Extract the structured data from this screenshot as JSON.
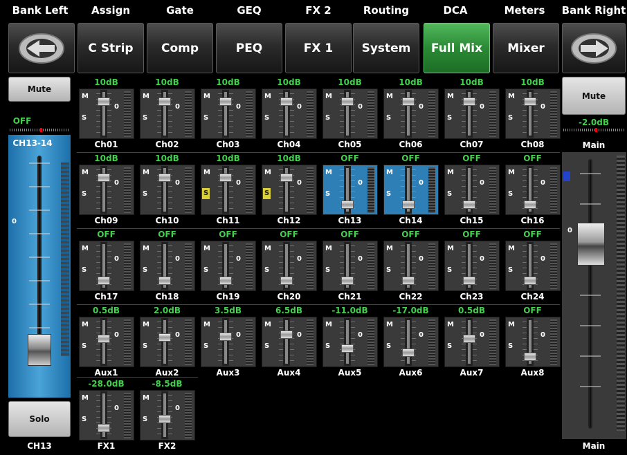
{
  "top_labels": [
    "Bank Left",
    "Assign",
    "Gate",
    "GEQ",
    "FX 2",
    "Routing",
    "DCA",
    "Meters",
    "Bank Right"
  ],
  "tabs": [
    {
      "label": "",
      "name": "bank-left-button",
      "icon": "arrow-left-icon"
    },
    {
      "label": "C Strip",
      "name": "tab-c-strip"
    },
    {
      "label": "Comp",
      "name": "tab-comp"
    },
    {
      "label": "PEQ",
      "name": "tab-peq"
    },
    {
      "label": "FX 1",
      "name": "tab-fx1"
    },
    {
      "label": "System",
      "name": "tab-system"
    },
    {
      "label": "Full Mix",
      "name": "tab-full-mix",
      "active": true
    },
    {
      "label": "Mixer",
      "name": "tab-mixer"
    },
    {
      "label": "",
      "name": "bank-right-button",
      "icon": "arrow-right-icon"
    }
  ],
  "left": {
    "mute_label": "Mute",
    "status": "OFF",
    "channel": "CH13-14",
    "scale_zero": "0",
    "solo_label": "Solo",
    "bottom_name": "CH13",
    "fader_level": 0.08
  },
  "right": {
    "mute_label": "Mute",
    "value": "-2.0dB",
    "label_top": "Main",
    "scale_zero": "0",
    "bottom_name": "Main",
    "fader_level": 0.72
  },
  "strip_text": {
    "m": "M",
    "s": "S",
    "zero": "0"
  },
  "strips": [
    {
      "v": "10dB",
      "n": "Ch01",
      "p": 0.15
    },
    {
      "v": "10dB",
      "n": "Ch02",
      "p": 0.15
    },
    {
      "v": "10dB",
      "n": "Ch03",
      "p": 0.15
    },
    {
      "v": "10dB",
      "n": "Ch04",
      "p": 0.15
    },
    {
      "v": "10dB",
      "n": "Ch05",
      "p": 0.15
    },
    {
      "v": "10dB",
      "n": "Ch06",
      "p": 0.15
    },
    {
      "v": "10dB",
      "n": "Ch07",
      "p": 0.15
    },
    {
      "v": "10dB",
      "n": "Ch08",
      "p": 0.15
    },
    {
      "v": "10dB",
      "n": "Ch09",
      "p": 0.15
    },
    {
      "v": "10dB",
      "n": "Ch10",
      "p": 0.15
    },
    {
      "v": "10dB",
      "n": "Ch11",
      "p": 0.15,
      "solo": true
    },
    {
      "v": "10dB",
      "n": "Ch12",
      "p": 0.15,
      "solo": true
    },
    {
      "v": "OFF",
      "n": "Ch13",
      "p": 0.9,
      "sel": true
    },
    {
      "v": "OFF",
      "n": "Ch14",
      "p": 0.9,
      "sel": true
    },
    {
      "v": "OFF",
      "n": "Ch15",
      "p": 0.9
    },
    {
      "v": "OFF",
      "n": "Ch16",
      "p": 0.9
    },
    {
      "v": "OFF",
      "n": "Ch17",
      "p": 0.9
    },
    {
      "v": "OFF",
      "n": "Ch18",
      "p": 0.9
    },
    {
      "v": "OFF",
      "n": "Ch19",
      "p": 0.9
    },
    {
      "v": "OFF",
      "n": "Ch20",
      "p": 0.9
    },
    {
      "v": "OFF",
      "n": "Ch21",
      "p": 0.9
    },
    {
      "v": "OFF",
      "n": "Ch22",
      "p": 0.9
    },
    {
      "v": "OFF",
      "n": "Ch23",
      "p": 0.9
    },
    {
      "v": "OFF",
      "n": "Ch24",
      "p": 0.9
    },
    {
      "v": "0.5dB",
      "n": "Aux1",
      "p": 0.4
    },
    {
      "v": "2.0dB",
      "n": "Aux2",
      "p": 0.37
    },
    {
      "v": "3.5dB",
      "n": "Aux3",
      "p": 0.34
    },
    {
      "v": "6.5dB",
      "n": "Aux4",
      "p": 0.28
    },
    {
      "v": "-11.0dB",
      "n": "Aux5",
      "p": 0.68
    },
    {
      "v": "-17.0dB",
      "n": "Aux6",
      "p": 0.78
    },
    {
      "v": "0.5dB",
      "n": "Aux7",
      "p": 0.4
    },
    {
      "v": "OFF",
      "n": "Aux8",
      "p": 0.9
    },
    {
      "v": "-28.0dB",
      "n": "FX1",
      "p": 0.85
    },
    {
      "v": "-8.5dB",
      "n": "FX2",
      "p": 0.6
    }
  ]
}
